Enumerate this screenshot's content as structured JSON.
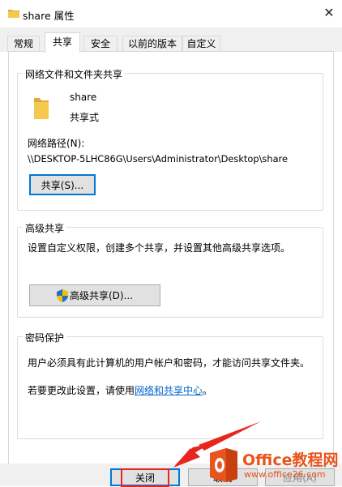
{
  "window": {
    "title": "share 属性",
    "close_glyph": "✕"
  },
  "tabs": [
    {
      "label": "常规",
      "active": false
    },
    {
      "label": "共享",
      "active": true
    },
    {
      "label": "安全",
      "active": false
    },
    {
      "label": "以前的版本",
      "active": false
    },
    {
      "label": "自定义",
      "active": false
    }
  ],
  "network_sharing": {
    "legend": "网络文件和文件夹共享",
    "folder_name": "share",
    "share_status": "共享式",
    "path_label": "网络路径(N):",
    "path_value": "\\\\DESKTOP-5LHC86G\\Users\\Administrator\\Desktop\\share",
    "share_button": "共享(S)..."
  },
  "advanced_sharing": {
    "legend": "高级共享",
    "description": "设置自定义权限，创建多个共享，并设置其他高级共享选项。",
    "button": "高级共享(D)..."
  },
  "password_protection": {
    "legend": "密码保护",
    "description": "用户必须具有此计算机的用户帐户和密码，才能访问共享文件夹。",
    "change_prefix": "若要更改此设置，请使用",
    "change_link": "网络和共享中心",
    "change_suffix": "。"
  },
  "buttons": {
    "close": "关闭",
    "cancel": "取消",
    "apply": "应用(A)"
  },
  "watermark": {
    "title": "Office教程网",
    "url": "www.office26.com"
  },
  "colors": {
    "accent": "#0078d7",
    "link": "#0066cc",
    "annotation_red": "#e8261e",
    "watermark_orange": "#e8541c",
    "folder_yellow": "#f4c94e"
  },
  "icons": [
    "folder-icon",
    "shield-icon",
    "close-icon"
  ]
}
